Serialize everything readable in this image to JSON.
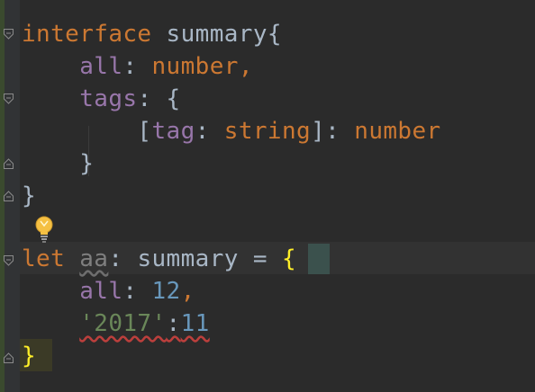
{
  "editor": {
    "lines": [
      {
        "tokens": [
          {
            "t": "interface",
            "c": "kw"
          },
          {
            "t": " summary{",
            "c": "plain"
          }
        ]
      },
      {
        "tokens": [
          {
            "t": "    ",
            "c": "plain"
          },
          {
            "t": "all",
            "c": "prop"
          },
          {
            "t": ": ",
            "c": "plain"
          },
          {
            "t": "number",
            "c": "kw"
          },
          {
            "t": ",",
            "c": "kw"
          }
        ]
      },
      {
        "tokens": [
          {
            "t": "    ",
            "c": "plain"
          },
          {
            "t": "tags",
            "c": "prop"
          },
          {
            "t": ": {",
            "c": "plain"
          }
        ]
      },
      {
        "tokens": [
          {
            "t": "        [",
            "c": "plain"
          },
          {
            "t": "tag",
            "c": "prop"
          },
          {
            "t": ": ",
            "c": "plain"
          },
          {
            "t": "string",
            "c": "kw"
          },
          {
            "t": "]: ",
            "c": "plain"
          },
          {
            "t": "number",
            "c": "kw"
          }
        ]
      },
      {
        "tokens": [
          {
            "t": "    }",
            "c": "plain"
          }
        ]
      },
      {
        "tokens": [
          {
            "t": "}",
            "c": "plain"
          }
        ]
      },
      {
        "tokens": []
      },
      {
        "tokens": [
          {
            "t": "let",
            "c": "kw"
          },
          {
            "t": " ",
            "c": "plain"
          },
          {
            "t": "aa",
            "c": "unused"
          },
          {
            "t": ": summary = ",
            "c": "plain"
          },
          {
            "t": "{",
            "c": "brace-yellow"
          }
        ]
      },
      {
        "tokens": [
          {
            "t": "    ",
            "c": "plain"
          },
          {
            "t": "all",
            "c": "prop"
          },
          {
            "t": ": ",
            "c": "plain"
          },
          {
            "t": "12",
            "c": "num"
          },
          {
            "t": ",",
            "c": "kw"
          }
        ]
      },
      {
        "tokens": [
          {
            "t": "    ",
            "c": "plain"
          },
          {
            "t": "'2017'",
            "c": "str err"
          },
          {
            "t": ":",
            "c": "plain err"
          },
          {
            "t": "11",
            "c": "num err"
          }
        ]
      },
      {
        "tokens": [
          {
            "t": "}",
            "c": "brace-yellow"
          }
        ]
      }
    ]
  }
}
